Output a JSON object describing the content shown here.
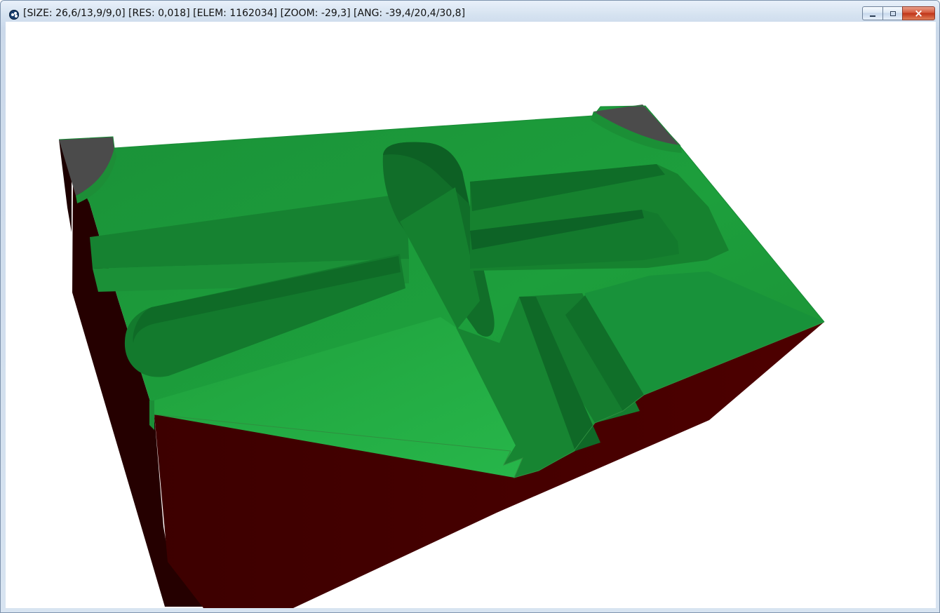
{
  "window": {
    "title": "[SIZE: 26,6/13,9/9,0] [RES: 0,018] [ELEM: 1162034] [ZOOM: -29,3] [ANG: -39,4/20,4/30,8]",
    "icon": "paw-icon",
    "controls": {
      "minimize": "minimize-icon",
      "maximize": "restore-icon",
      "close": "close-icon"
    }
  },
  "viewport": {
    "background": "#ffffff",
    "model_colors": {
      "top": "#1f9d3d",
      "pocket": "#178432",
      "pocket_dark": "#0f6d29",
      "side_front": "#450000",
      "side_left": "#2a0000",
      "corner_gray": "#4b4b4b"
    }
  }
}
